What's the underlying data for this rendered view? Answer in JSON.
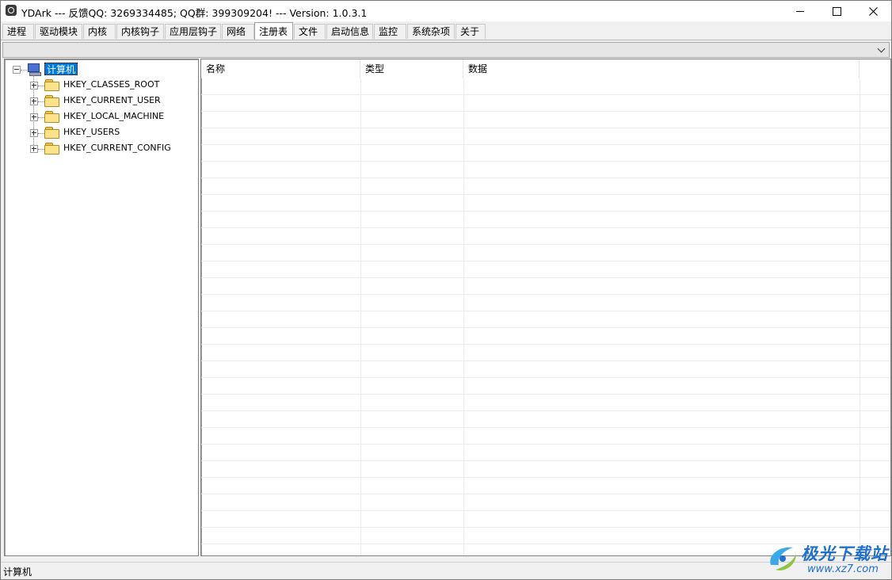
{
  "window": {
    "title": "YDArk --- 反馈QQ: 3269334485; QQ群: 399309204! --- Version: 1.0.3.1"
  },
  "tabs": [
    {
      "label": "进程"
    },
    {
      "label": "驱动模块"
    },
    {
      "label": "内核"
    },
    {
      "label": "内核钩子"
    },
    {
      "label": "应用层钩子"
    },
    {
      "label": "网络"
    },
    {
      "label": "注册表",
      "active": true
    },
    {
      "label": "文件"
    },
    {
      "label": "启动信息"
    },
    {
      "label": "监控"
    },
    {
      "label": "系统杂项"
    },
    {
      "label": "关于"
    }
  ],
  "tree": {
    "root": {
      "label": "计算机",
      "icon": "computer-icon",
      "expanded": true
    },
    "hives": [
      {
        "label": "HKEY_CLASSES_ROOT",
        "icon": "folder-icon"
      },
      {
        "label": "HKEY_CURRENT_USER",
        "icon": "folder-icon"
      },
      {
        "label": "HKEY_LOCAL_MACHINE",
        "icon": "folder-icon"
      },
      {
        "label": "HKEY_USERS",
        "icon": "folder-icon"
      },
      {
        "label": "HKEY_CURRENT_CONFIG",
        "icon": "folder-icon"
      }
    ]
  },
  "list": {
    "columns": [
      {
        "label": "名称"
      },
      {
        "label": "类型"
      },
      {
        "label": "数据"
      }
    ],
    "rows": []
  },
  "statusbar": {
    "text": "计算机"
  },
  "watermark": {
    "main": "极光下载站",
    "sub": "www.xz7.com"
  },
  "colors": {
    "selection": "#0078d7",
    "watermark": "#1f6fd1"
  }
}
